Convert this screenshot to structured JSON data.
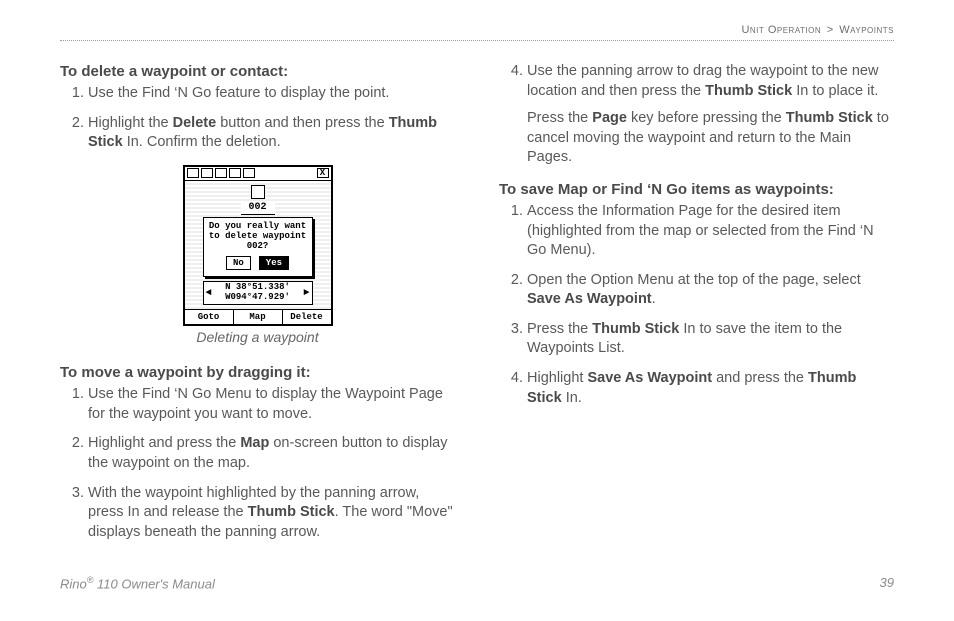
{
  "breadcrumb": {
    "section": "Unit Operation",
    "sep": ">",
    "page": "Waypoints"
  },
  "left": {
    "h1": "To delete a waypoint or contact:",
    "l1": {
      "i1": "Use the Find ‘N Go feature to display the point.",
      "i2a": "Highlight the ",
      "i2b": "Delete",
      "i2c": " button and then press the ",
      "i2d": "Thumb Stick",
      "i2e": " In. Confirm the deletion."
    },
    "figure": {
      "name": "002",
      "dialog_l1": "Do you really want",
      "dialog_l2": "to delete waypoint",
      "dialog_l3": "002?",
      "no": "No",
      "yes": "Yes",
      "coord_l1": "N  38°51.338'",
      "coord_l2": "W094°47.929'",
      "goto": "Goto",
      "map": "Map",
      "delete": "Delete",
      "caption": "Deleting a waypoint"
    },
    "h2": "To move a waypoint by dragging it:",
    "l2": {
      "i1": "Use the Find ‘N Go Menu to display the Waypoint Page for the waypoint you want to move.",
      "i2a": "Highlight and press the ",
      "i2b": "Map",
      "i2c": " on-screen button to display the waypoint on the map.",
      "i3a": "With the waypoint highlighted by the panning arrow, press In and release the ",
      "i3b": "Thumb Stick",
      "i3c": ". The word \"Move\" displays beneath the panning arrow."
    }
  },
  "right": {
    "cont": {
      "i4a": "Use the panning arrow to drag the waypoint to the new location and then press the ",
      "i4b": "Thumb Stick",
      "i4c": " In to place it.",
      "pa": "Press the ",
      "pb": "Page",
      "pc": " key before pressing the ",
      "pd": "Thumb Stick",
      "pe": " to cancel moving the waypoint and return to the Main Pages."
    },
    "h3": "To save Map or Find ‘N Go items as waypoints:",
    "l3": {
      "i1": "Access the Information Page for the desired item (highlighted from the map or selected from the Find ‘N Go Menu).",
      "i2a": "Open the Option Menu at the top of the page, select ",
      "i2b": "Save As Waypoint",
      "i2c": ".",
      "i3a": "Press the ",
      "i3b": "Thumb Stick",
      "i3c": " In to save the item to the Waypoints List.",
      "i4a": "Highlight ",
      "i4b": "Save As Waypoint",
      "i4c": " and press the ",
      "i4d": "Thumb Stick",
      "i4e": " In."
    }
  },
  "footer": {
    "left_a": "Rino",
    "left_sup": "®",
    "left_b": " 110 Owner's Manual",
    "right": "39"
  }
}
